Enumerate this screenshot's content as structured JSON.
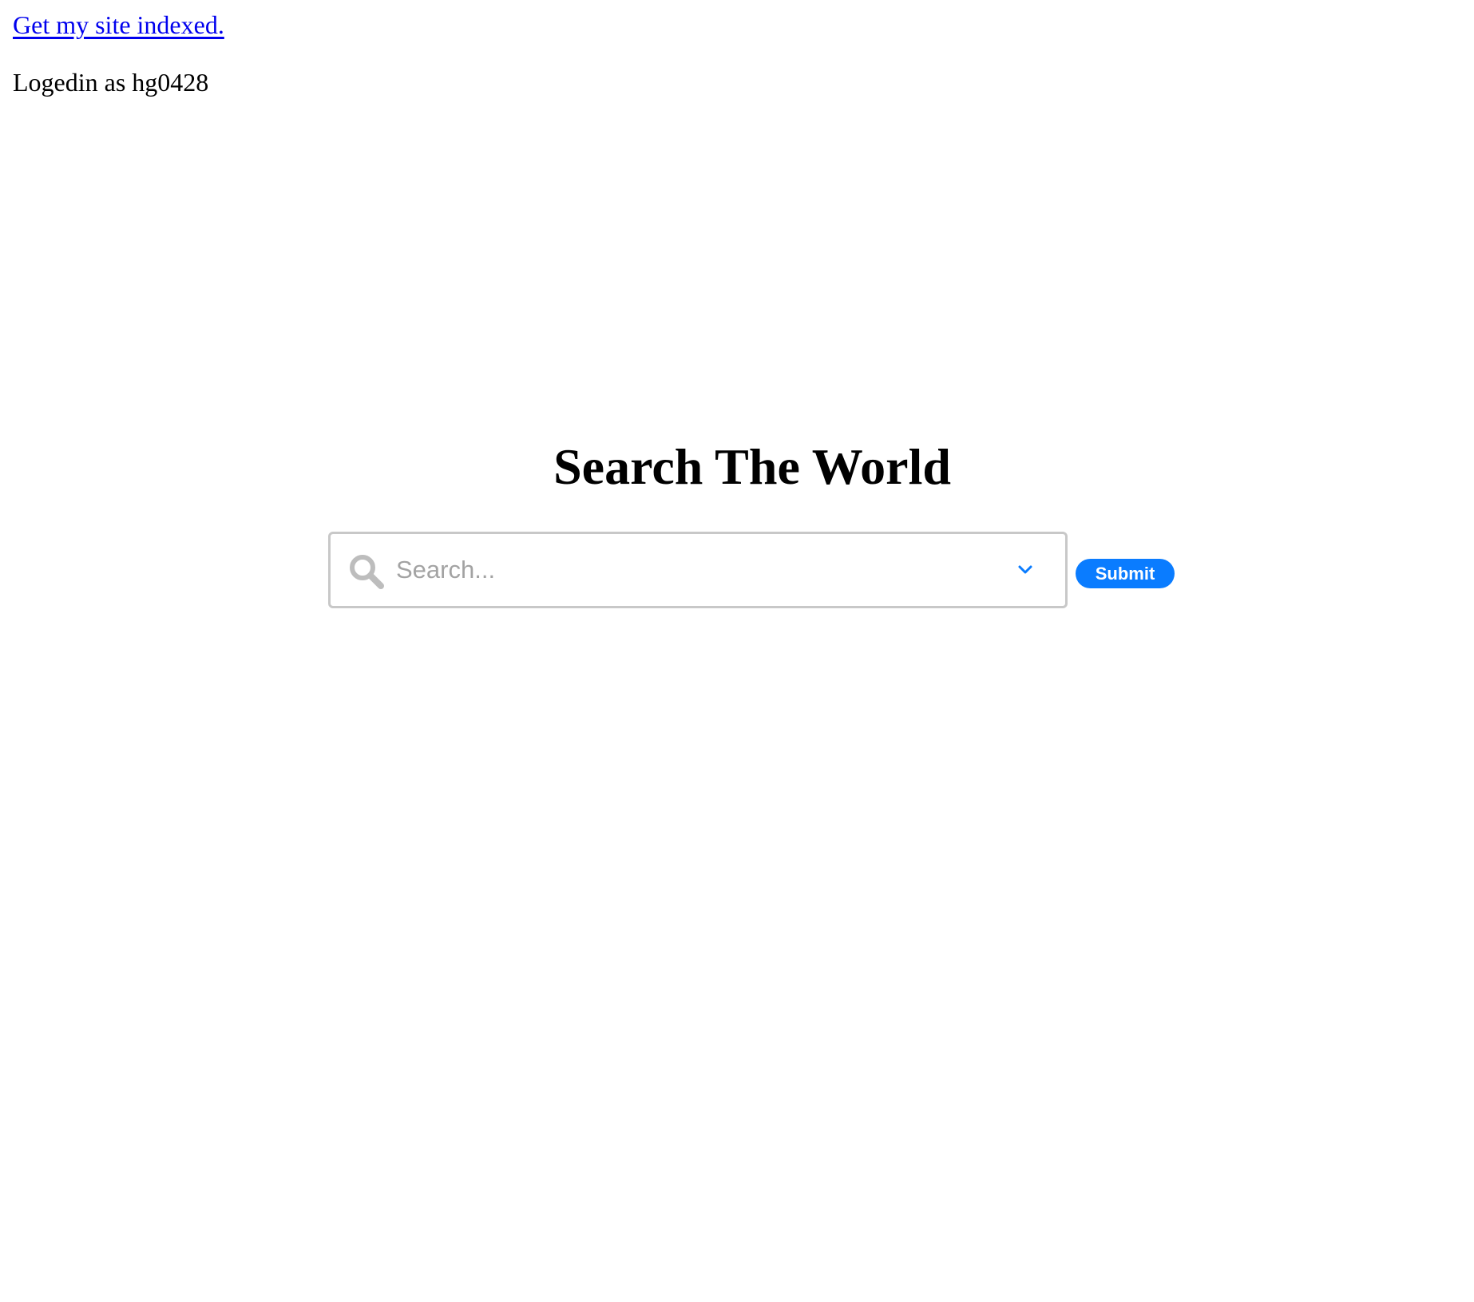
{
  "header": {
    "index_link_label": "Get my site indexed.",
    "logged_in_text": "Logedin as hg0428"
  },
  "main": {
    "title": "Search The World",
    "search": {
      "placeholder": "Search...",
      "value": "",
      "icon": "search-icon",
      "dropdown_icon": "chevron-down-icon"
    },
    "submit_label": "Submit"
  },
  "colors": {
    "link": "#0000ee",
    "accent": "#0a7cff",
    "search_border": "#c8c8c8",
    "placeholder": "#a3a3a3"
  }
}
